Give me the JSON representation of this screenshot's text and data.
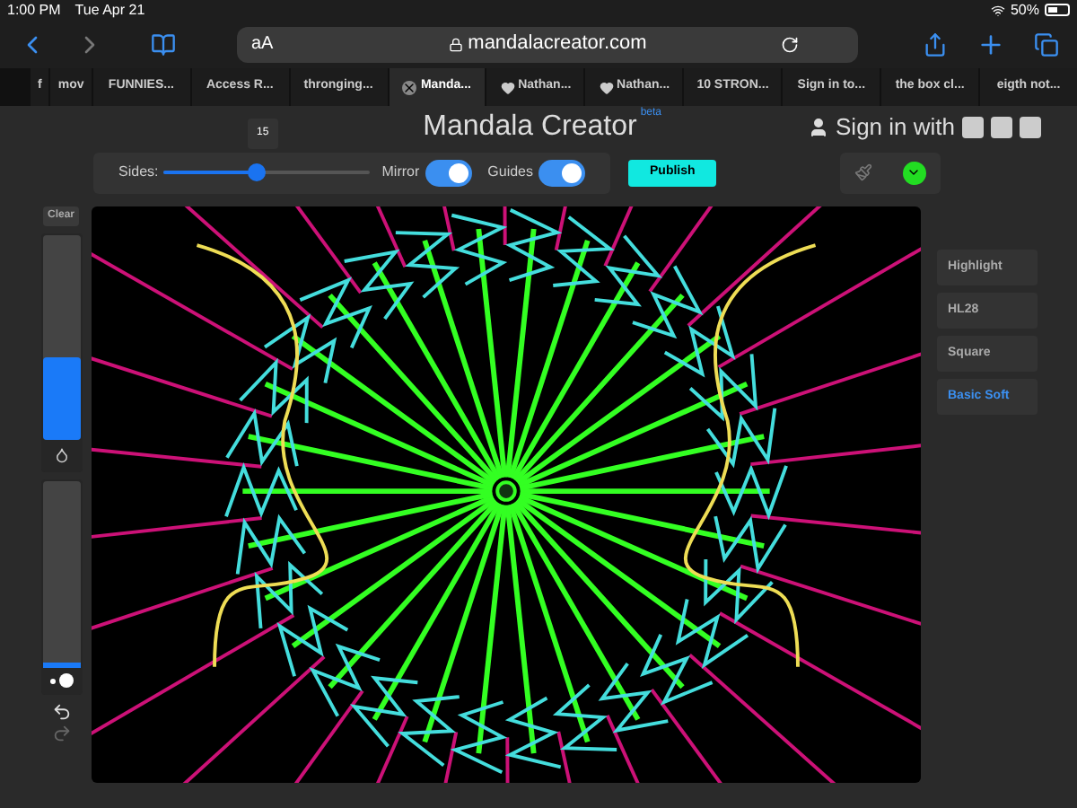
{
  "status_bar": {
    "time": "1:00 PM",
    "date": "Tue Apr 21",
    "battery": "50%"
  },
  "browser": {
    "text_size": "aA",
    "url": "mandalacreator.com"
  },
  "tabs": [
    {
      "label": "f",
      "selected": false,
      "heart": false
    },
    {
      "label": "mov",
      "selected": false,
      "heart": false
    },
    {
      "label": "FUNNIES...",
      "selected": false,
      "heart": false
    },
    {
      "label": "Access R...",
      "selected": false,
      "heart": false
    },
    {
      "label": "thronging...",
      "selected": false,
      "heart": false
    },
    {
      "label": "Manda...",
      "selected": true,
      "heart": false
    },
    {
      "label": "Nathan...",
      "selected": false,
      "heart": true
    },
    {
      "label": "Nathan...",
      "selected": false,
      "heart": true
    },
    {
      "label": "10 STRON...",
      "selected": false,
      "heart": false
    },
    {
      "label": "Sign in to...",
      "selected": false,
      "heart": false
    },
    {
      "label": "the box cl...",
      "selected": false,
      "heart": false
    },
    {
      "label": "eigth not...",
      "selected": false,
      "heart": false
    }
  ],
  "header": {
    "title": "Mandala Creator",
    "badge": "beta",
    "sign_in": "Sign in with"
  },
  "controls": {
    "sides_label": "Sides:",
    "sides_value": "15",
    "sides_slider": {
      "level": 0.45
    },
    "mirror_label": "Mirror",
    "mirror_on": true,
    "guides_label": "Guides",
    "guides_on": true,
    "publish": "Publish",
    "color": "#22dd22"
  },
  "left_panel": {
    "clear": "Clear",
    "opacity_slider": {
      "level": 0.4
    },
    "size_slider": {
      "level": 0.03
    }
  },
  "brushes": [
    {
      "label": "Highlight",
      "selected": false
    },
    {
      "label": "HL28",
      "selected": false
    },
    {
      "label": "Square",
      "selected": false
    },
    {
      "label": "Basic Soft",
      "selected": true
    }
  ]
}
